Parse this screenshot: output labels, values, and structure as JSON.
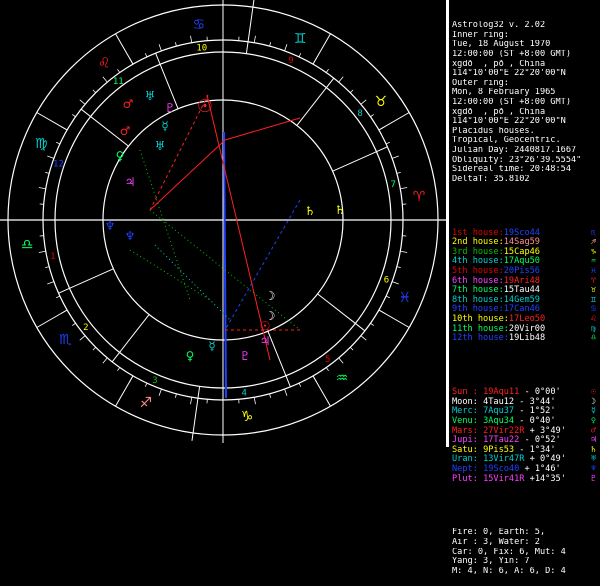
{
  "header": {
    "lines": [
      "Astrolog32 v. 2.02",
      "Inner ring:",
      "Tue, 18 August 1970",
      "12:00:00 (ST +8:00 GMT)",
      "xgdð  , pð , China",
      "114°10'00\"E 22°20'00\"N",
      "Outer ring:",
      "Mon, 8 February 1965",
      "12:00:00 (ST +8:00 GMT)",
      "xgdð  , pð , China",
      "114°10'00\"E 22°20'00\"N",
      "Placidus houses.",
      "Tropical, Geocentric.",
      "Julian Day: 2440817.1667",
      "Obliquity: 23°26'39.5554\"",
      "Sidereal time: 20:48:54",
      "DeltaT: 35.8102"
    ]
  },
  "houses": [
    {
      "label": "1st house:",
      "pos": "19Sco44",
      "glyph": "♏",
      "lc": "#e00000",
      "pc": "#2040ff",
      "gc": "#2040ff"
    },
    {
      "label": "2nd house:",
      "pos": "14Sag59",
      "glyph": "♐",
      "lc": "#ffff00",
      "pc": "#ff9090",
      "gc": "#ff9090"
    },
    {
      "label": "3rd house:",
      "pos": "15Cap46",
      "glyph": "♑",
      "lc": "#00c000",
      "pc": "#ffff00",
      "gc": "#ffff00"
    },
    {
      "label": "4th house:",
      "pos": "17Aqu50",
      "glyph": "♒",
      "lc": "#00d0d0",
      "pc": "#00ff60",
      "gc": "#00ff60"
    },
    {
      "label": "5th house:",
      "pos": "20Pis56",
      "glyph": "♓",
      "lc": "#e00000",
      "pc": "#2040ff",
      "gc": "#2040ff"
    },
    {
      "label": "6th house:",
      "pos": "19Ari48",
      "glyph": "♈",
      "lc": "#ff40ff",
      "pc": "#ff2020",
      "gc": "#ff2020"
    },
    {
      "label": "7th house:",
      "pos": "15Tau44",
      "glyph": "♉",
      "lc": "#00ff60",
      "pc": "#ffffff",
      "gc": "#ffff00"
    },
    {
      "label": "8th house:",
      "pos": "14Gem59",
      "glyph": "♊",
      "lc": "#00d0d0",
      "pc": "#00d0d0",
      "gc": "#00d0d0"
    },
    {
      "label": "9th house:",
      "pos": "17Can46",
      "glyph": "♋",
      "lc": "#2040ff",
      "pc": "#2040ff",
      "gc": "#2040ff"
    },
    {
      "label": "10th house:",
      "pos": "17Leo50",
      "glyph": "♌",
      "lc": "#ffff00",
      "pc": "#ff2020",
      "gc": "#ff2020"
    },
    {
      "label": "11th house:",
      "pos": "20Vir00",
      "glyph": "♍",
      "lc": "#00ff60",
      "pc": "#ffffff",
      "gc": "#00d0d0"
    },
    {
      "label": "12th house:",
      "pos": "19Lib48",
      "glyph": "♎",
      "lc": "#2040ff",
      "pc": "#ffffff",
      "gc": "#00ff60"
    }
  ],
  "planets": [
    {
      "name": "Sun :",
      "pos": "19Aqu11",
      "aspect": "- 0°00'",
      "glyph": "☉",
      "nc": "#ff2020",
      "pc": "#ff2020",
      "gc": "#ff2020"
    },
    {
      "name": "Moon:",
      "pos": "4Tau12",
      "aspect": "- 3°44'",
      "glyph": "☽",
      "nc": "#ffffff",
      "pc": "#ffffff",
      "gc": "#ffffff"
    },
    {
      "name": "Merc:",
      "pos": "7Aqu37",
      "aspect": "- 1°52'",
      "glyph": "☿",
      "nc": "#00d0d0",
      "pc": "#00d0d0",
      "gc": "#00d0d0"
    },
    {
      "name": "Venu:",
      "pos": "3Aqu34",
      "aspect": "- 0°40'",
      "glyph": "♀",
      "nc": "#00ff60",
      "pc": "#00ff60",
      "gc": "#00ff60"
    },
    {
      "name": "Mars:",
      "pos": "27Vir22R",
      "aspect": "+ 3°49'",
      "glyph": "♂",
      "nc": "#ff2020",
      "pc": "#ff2020",
      "gc": "#ff2020"
    },
    {
      "name": "Jupi:",
      "pos": "17Tau22",
      "aspect": "- 0°52'",
      "glyph": "♃",
      "nc": "#ff40ff",
      "pc": "#ff40ff",
      "gc": "#ff40ff"
    },
    {
      "name": "Satu:",
      "pos": "9Pis53",
      "aspect": "- 1°34'",
      "glyph": "♄",
      "nc": "#ffff00",
      "pc": "#ffff00",
      "gc": "#ffff00"
    },
    {
      "name": "Uran:",
      "pos": "13Vir47R",
      "aspect": "+ 0°49'",
      "glyph": "♅",
      "nc": "#00d0d0",
      "pc": "#00d0d0",
      "gc": "#00d0d0"
    },
    {
      "name": "Nept:",
      "pos": "19Sco40",
      "aspect": "+ 1°46'",
      "glyph": "♆",
      "nc": "#2040ff",
      "pc": "#2040ff",
      "gc": "#2040ff"
    },
    {
      "name": "Plut:",
      "pos": "15Vir41R",
      "aspect": "+14°35'",
      "glyph": "♇",
      "nc": "#ff40ff",
      "pc": "#ff40ff",
      "gc": "#ff40ff"
    }
  ],
  "elements": [
    "Fire: 0, Earth: 5,",
    "Air : 3, Water: 2",
    "Car: 0, Fix: 6, Mut: 4",
    "Yang: 3, Yin: 7",
    "M: 4, N: 6, A: 6, D: 4"
  ],
  "wheel": {
    "signs": [
      {
        "glyph": "♈",
        "color": "#ff2020"
      },
      {
        "glyph": "♉",
        "color": "#ffff00"
      },
      {
        "glyph": "♊",
        "color": "#00d0d0"
      },
      {
        "glyph": "♋",
        "color": "#2040ff"
      },
      {
        "glyph": "♌",
        "color": "#ff2020"
      },
      {
        "glyph": "♍",
        "color": "#00d0d0"
      },
      {
        "glyph": "♎",
        "color": "#00ff60"
      },
      {
        "glyph": "♏",
        "color": "#2040ff"
      },
      {
        "glyph": "♐",
        "color": "#ff9090"
      },
      {
        "glyph": "♑",
        "color": "#ffff00"
      },
      {
        "glyph": "♒",
        "color": "#00ff60"
      },
      {
        "glyph": "♓",
        "color": "#2040ff"
      }
    ],
    "houses": [
      {
        "num": "1",
        "color": "#e00000"
      },
      {
        "num": "2",
        "color": "#ffff00"
      },
      {
        "num": "3",
        "color": "#00c000"
      },
      {
        "num": "4",
        "color": "#00d0d0"
      },
      {
        "num": "5",
        "color": "#e00000"
      },
      {
        "num": "6",
        "color": "#ffff00"
      },
      {
        "num": "7",
        "color": "#00ff60"
      },
      {
        "num": "8",
        "color": "#00d0d0"
      },
      {
        "num": "9",
        "color": "#e00000"
      },
      {
        "num": "10",
        "color": "#ffff00"
      },
      {
        "num": "11",
        "color": "#00ff60"
      },
      {
        "num": "12",
        "color": "#2040ff"
      }
    ],
    "planet_glyphs": [
      {
        "glyph": "♂",
        "color": "#ff2020"
      },
      {
        "glyph": "♅",
        "color": "#00d0d0"
      },
      {
        "glyph": "♇",
        "color": "#ff40ff"
      },
      {
        "glyph": "☿",
        "color": "#00d0d0"
      },
      {
        "glyph": "♀",
        "color": "#00ff60"
      },
      {
        "glyph": "♃",
        "color": "#ff40ff"
      },
      {
        "glyph": "♄",
        "color": "#ffff00"
      },
      {
        "glyph": "☽",
        "color": "#ffffff"
      },
      {
        "glyph": "☉",
        "color": "#ff2020"
      },
      {
        "glyph": "♆",
        "color": "#2040ff"
      },
      {
        "glyph": "♂",
        "color": "#ff2020"
      },
      {
        "glyph": "♀",
        "color": "#00ff60"
      },
      {
        "glyph": "☿",
        "color": "#00d0d0"
      },
      {
        "glyph": "☉",
        "color": "#ff2020"
      },
      {
        "glyph": "♄",
        "color": "#ffff00"
      },
      {
        "glyph": "♆",
        "color": "#2040ff"
      },
      {
        "glyph": "♃",
        "color": "#ff40ff"
      },
      {
        "glyph": "☽",
        "color": "#ffffff"
      },
      {
        "glyph": "♅",
        "color": "#00d0d0"
      },
      {
        "glyph": "♇",
        "color": "#ff40ff"
      }
    ]
  }
}
